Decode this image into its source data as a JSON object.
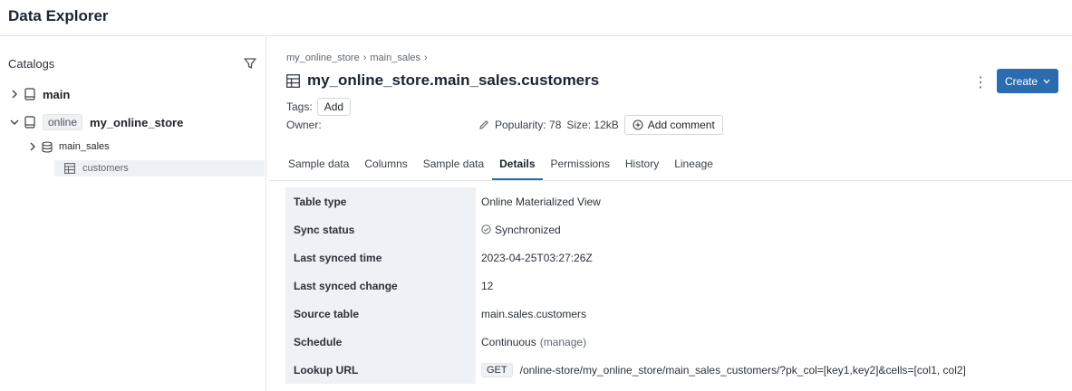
{
  "app": {
    "title": "Data Explorer"
  },
  "sidebar": {
    "catalogs_label": "Catalogs",
    "tree": {
      "main": "main",
      "online_badge": "online",
      "my_online_store": "my_online_store",
      "main_sales": "main_sales",
      "customers": "customers"
    }
  },
  "breadcrumb": {
    "part1": "my_online_store",
    "sep1": "›",
    "part2": "main_sales",
    "sep2": "›"
  },
  "page": {
    "title": "my_online_store.main_sales.customers",
    "create_label": "Create",
    "tags_label": "Tags:",
    "add_label": "Add",
    "owner_label": "Owner:",
    "popularity": "Popularity: 78",
    "size": "Size: 12kB",
    "add_comment": "Add comment"
  },
  "tabs": [
    "Sample data",
    "Columns",
    "Sample data",
    "Details",
    "Permissions",
    "History",
    "Lineage"
  ],
  "active_tab": "Details",
  "details": [
    {
      "key": "Table type",
      "value": "Online Materialized View"
    },
    {
      "key": "Sync status",
      "value": "Synchronized"
    },
    {
      "key": "Last synced time",
      "value": "2023-04-25T03:27:26Z"
    },
    {
      "key": "Last synced change",
      "value": "12"
    },
    {
      "key": "Source table",
      "value": "main.sales.customers"
    },
    {
      "key": "Schedule",
      "value": "Continuous",
      "link": "(manage)"
    },
    {
      "key": "Lookup URL",
      "method": "GET",
      "value": "/online-store/my_online_store/main_sales_customers/?pk_col=[key1,key2]&cells=[col1, col2]"
    }
  ],
  "colors": {
    "accent": "#2b6cb0",
    "key_bg": "#eef1f5",
    "selected_row": "#eef2f6"
  }
}
